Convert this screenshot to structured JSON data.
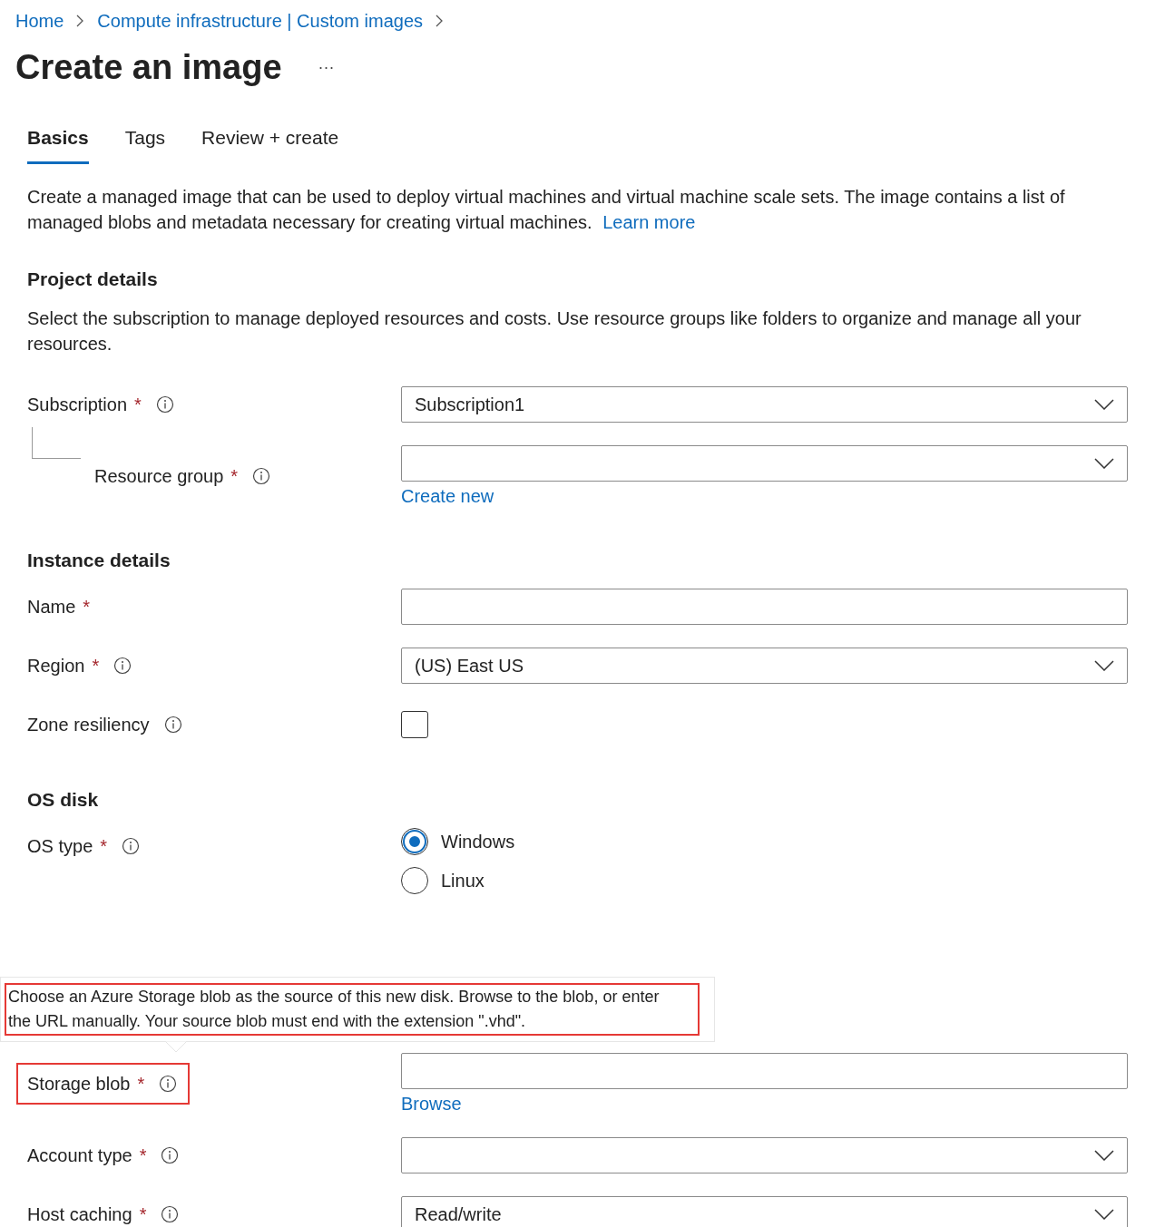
{
  "breadcrumb": [
    "Home",
    "Compute infrastructure | Custom images"
  ],
  "title": "Create an image",
  "more": "···",
  "tabs": [
    {
      "label": "Basics",
      "selected": true
    },
    {
      "label": "Tags",
      "selected": false
    },
    {
      "label": "Review + create",
      "selected": false
    }
  ],
  "intro": {
    "text": "Create a managed image that can be used to deploy virtual machines and virtual machine scale sets. The image contains a list of managed blobs and metadata necessary for creating virtual machines.",
    "link": "Learn more"
  },
  "sections": [
    {
      "heading": "Project details",
      "description": "Select the subscription to manage deployed resources and costs. Use resource groups like folders to organize and manage all your resources.",
      "fields": [
        {
          "kind": "dropdown",
          "label": "Subscription",
          "required_mark": "*",
          "info": true,
          "value": "Subscription1",
          "children": [
            {
              "kind": "dropdown",
              "label": "Resource group",
              "required_mark": "*",
              "info": true,
              "link": "Create new"
            }
          ]
        }
      ]
    },
    {
      "heading": "Instance details",
      "fields": [
        {
          "kind": "text",
          "label": "Name",
          "required_mark": "*",
          "info": false
        },
        {
          "kind": "dropdown",
          "label": "Region",
          "required_mark": "*",
          "info": true,
          "value": "(US) East US"
        },
        {
          "kind": "checkbox",
          "label": "Zone resiliency",
          "info": true,
          "checked": false
        }
      ]
    },
    {
      "heading": "OS disk",
      "fields": [
        {
          "kind": "radio",
          "label": "OS type",
          "required_mark": "*",
          "info": true,
          "options": [
            {
              "label": "Windows",
              "selected": true
            },
            {
              "label": "Linux",
              "selected": false
            }
          ]
        },
        {
          "kind": "text",
          "label": "Storage blob",
          "required_mark": "*",
          "info": true,
          "highlighted": true,
          "link": "Browse",
          "tooltip": {
            "text": "Choose an Azure Storage blob as the source of this new disk. Browse to the blob, or enter the URL manually. Your source blob must end with the extension \".vhd\".",
            "highlighted": true
          }
        },
        {
          "kind": "dropdown",
          "label": "Account type",
          "required_mark": "*",
          "info": true
        },
        {
          "kind": "dropdown",
          "label": "Host caching",
          "required_mark": "*",
          "info": true,
          "value": "Read/write"
        }
      ]
    }
  ]
}
